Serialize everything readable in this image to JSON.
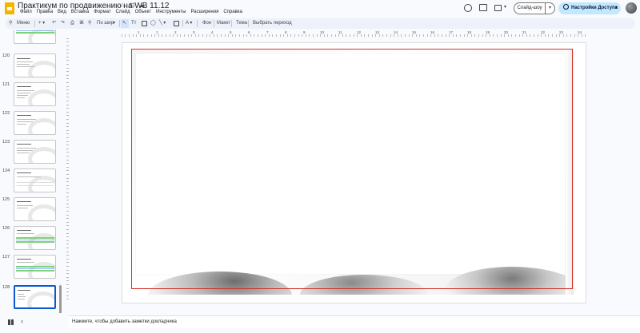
{
  "document": {
    "title": "Практикум по продвижению на WB 11.12"
  },
  "menu": [
    "Файл",
    "Правка",
    "Вид",
    "Вставка",
    "Формат",
    "Слайд",
    "Объект",
    "Инструменты",
    "Расширения",
    "Справка"
  ],
  "header": {
    "slideshow_label": "Слайд-шоу",
    "share_label": "Настройки Доступа",
    "caret": "▾"
  },
  "toolbar": {
    "menu_label": "Меню",
    "zoom_label": "По шир",
    "background_label": "Фон",
    "layout_label": "Макет",
    "theme_label": "Тема",
    "transition_label": "Выбрать переход"
  },
  "slides": [
    {
      "number": "",
      "variant": "top"
    },
    {
      "number": "120",
      "variant": "text"
    },
    {
      "number": "121",
      "variant": "text"
    },
    {
      "number": "122",
      "variant": "text"
    },
    {
      "number": "123",
      "variant": "text"
    },
    {
      "number": "124",
      "variant": "table"
    },
    {
      "number": "125",
      "variant": "text"
    },
    {
      "number": "126",
      "variant": "green"
    },
    {
      "number": "127",
      "variant": "green"
    },
    {
      "number": "128",
      "variant": "selected"
    }
  ],
  "ruler": {
    "marks": [
      "1",
      "1",
      "2",
      "3",
      "4",
      "5",
      "6",
      "7",
      "8",
      "9",
      "10",
      "11",
      "12",
      "13",
      "14",
      "15",
      "16",
      "17",
      "18",
      "19",
      "20",
      "21",
      "22",
      "23",
      "24",
      "25"
    ]
  },
  "notes": {
    "placeholder": "Нажмите, чтобы добавить заметки докладчика"
  },
  "colors": {
    "accent": "#0b57d0",
    "share_bg": "#c2e7ff",
    "selection": "#d93025"
  }
}
